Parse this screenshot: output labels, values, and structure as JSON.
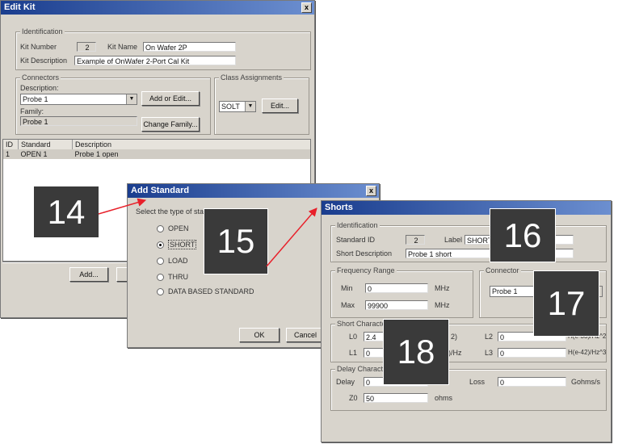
{
  "edit_kit": {
    "title": "Edit Kit",
    "close": "x",
    "identification": {
      "legend": "Identification",
      "kit_number_label": "Kit Number",
      "kit_number": "2",
      "kit_name_label": "Kit Name",
      "kit_name": "On Wafer 2P",
      "kit_desc_label": "Kit Description",
      "kit_desc": "Example of OnWafer 2-Port Cal Kit"
    },
    "connectors": {
      "legend": "Connectors",
      "description_label": "Description:",
      "description_value": "Probe 1",
      "add_or_edit": "Add or Edit...",
      "family_label": "Family:",
      "family_value": "Probe 1",
      "change_family": "Change Family..."
    },
    "class_assignments": {
      "legend": "Class Assignments",
      "value": "SOLT",
      "edit": "Edit..."
    },
    "table": {
      "headers": [
        "ID",
        "Standard",
        "Description"
      ],
      "rows": [
        [
          "1",
          "OPEN 1",
          "Probe 1 open"
        ]
      ]
    },
    "add_button": "Add..."
  },
  "add_standard": {
    "title": "Add Standard",
    "close": "x",
    "prompt": "Select the type of stan",
    "options": [
      {
        "label": "OPEN",
        "selected": false
      },
      {
        "label": "SHORT",
        "selected": true
      },
      {
        "label": "LOAD",
        "selected": false
      },
      {
        "label": "THRU",
        "selected": false
      },
      {
        "label": "DATA BASED STANDARD",
        "selected": false
      }
    ],
    "ok": "OK",
    "cancel": "Cancel"
  },
  "shorts": {
    "title": "Shorts",
    "identification": {
      "legend": "Identification",
      "standard_id_label": "Standard ID",
      "standard_id": "2",
      "label_label": "Label",
      "label_value": "SHORT",
      "short_desc_label": "Short Description",
      "short_desc": "Probe 1 short"
    },
    "frequency": {
      "legend": "Frequency Range",
      "min_label": "Min",
      "min": "0",
      "max_label": "Max",
      "max": "99900",
      "unit_min": "MHz",
      "unit_max": "MHz"
    },
    "connector": {
      "legend": "Connector",
      "value": "Probe 1"
    },
    "short_char": {
      "legend": "Short Character",
      "l0_label": "L0",
      "l0": "2.4",
      "l1_label": "L1",
      "l1": "0",
      "l2_label": "L2",
      "l2": "0",
      "l3_label": "L3",
      "l3": "0",
      "unit_l0": "2)",
      "unit_l1": "4)/Hz",
      "unit_l2": "H(e-33)/Hz^2",
      "unit_l3": "H(e-42)/Hz^3"
    },
    "delay": {
      "legend": "Delay Characte",
      "delay_label": "Delay",
      "delay": "0",
      "loss_label": "Loss",
      "loss": "0",
      "loss_unit": "Gohms/s",
      "z0_label": "Z0",
      "z0": "50",
      "z0_unit": "ohms"
    }
  },
  "callouts": [
    "14",
    "15",
    "16",
    "17",
    "18"
  ],
  "colors": {
    "title_bar": "#1a3d8e",
    "dialog_bg": "#d8d4cc",
    "callout_bg": "#3a3a3a",
    "arrow": "#e8202a"
  }
}
